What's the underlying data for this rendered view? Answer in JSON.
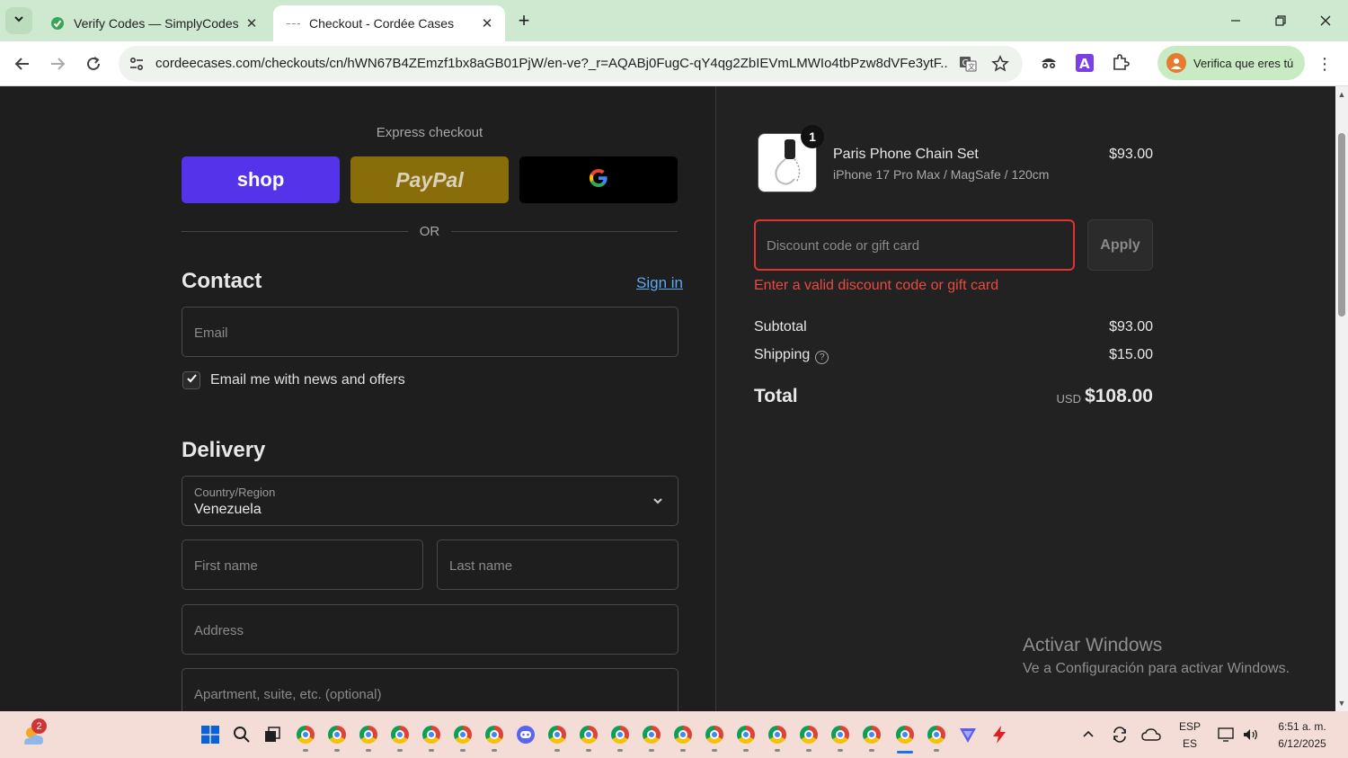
{
  "browser": {
    "tabs": [
      {
        "title": "Verify Codes — SimplyCodes",
        "active": false,
        "favicon": "simplycodes-icon"
      },
      {
        "title": "Checkout - Cordée Cases",
        "active": true,
        "favicon": "cordee-icon"
      }
    ],
    "url": "cordeecases.com/checkouts/cn/hWN67B4ZEmzf1bx8aGB01PjW/en-ve?_r=AQABj0FugC-qY4qg2ZbIEVmLMWIo4tbPzw8dVFe3ytF...",
    "profile_pill": "Verifica que eres tú"
  },
  "checkout": {
    "express_label": "Express checkout",
    "shop_label": "shop",
    "paypal_label": "PayPal",
    "google_label": "G",
    "or_label": "OR",
    "contact": {
      "title": "Contact",
      "sign_in": "Sign in",
      "email_placeholder": "Email",
      "newsletter_label": "Email me with news and offers",
      "newsletter_checked": true
    },
    "delivery": {
      "title": "Delivery",
      "country_label": "Country/Region",
      "country_value": "Venezuela",
      "first_name_placeholder": "First name",
      "last_name_placeholder": "Last name",
      "address_placeholder": "Address",
      "apartment_placeholder": "Apartment, suite, etc. (optional)"
    }
  },
  "order_summary": {
    "item": {
      "quantity": "1",
      "name": "Paris Phone Chain Set",
      "variant": "iPhone 17 Pro Max / MagSafe / 120cm",
      "price": "$93.00"
    },
    "discount_placeholder": "Discount code or gift card",
    "apply_label": "Apply",
    "error": "Enter a valid discount code or gift card",
    "subtotal_label": "Subtotal",
    "subtotal_value": "$93.00",
    "shipping_label": "Shipping",
    "shipping_value": "$15.00",
    "total_label": "Total",
    "total_currency": "USD",
    "total_value": "$108.00"
  },
  "watermark": {
    "title": "Activar Windows",
    "subtitle": "Ve a Configuración para activar Windows."
  },
  "taskbar": {
    "weather_badge": "2",
    "lang_top": "ESP",
    "lang_bottom": "ES",
    "time": "6:51 a. m.",
    "date": "6/12/2025"
  },
  "colors": {
    "shop": "#5433eb",
    "paypal": "#8a6d0b",
    "error": "#e84a42",
    "link": "#5ea8f0",
    "tabbar": "#cfe9d0"
  }
}
